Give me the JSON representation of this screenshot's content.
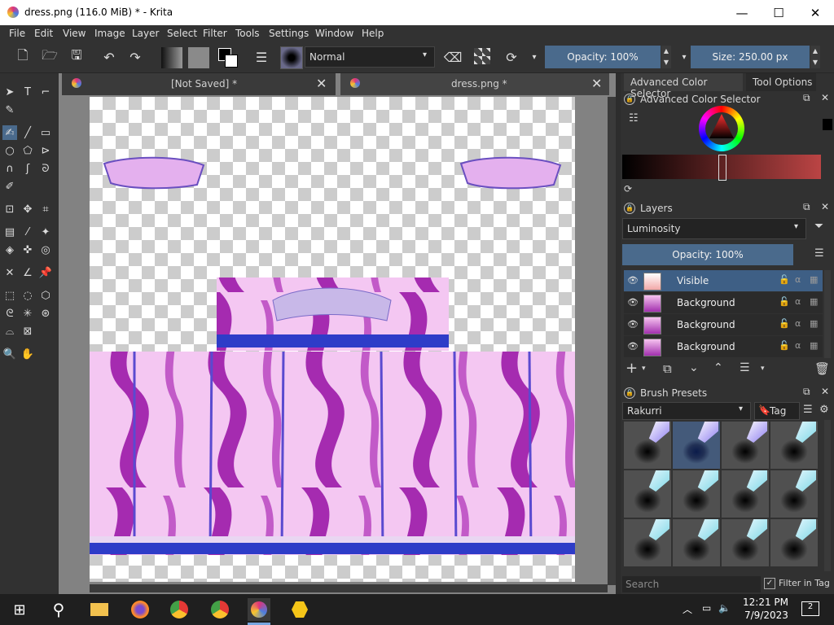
{
  "window": {
    "title": "dress.png (116.0 MiB)  * - Krita",
    "min": "—",
    "max": "☐",
    "close": "✕"
  },
  "menu": [
    "File",
    "Edit",
    "View",
    "Image",
    "Layer",
    "Select",
    "Filter",
    "Tools",
    "Settings",
    "Window",
    "Help"
  ],
  "toolbar": {
    "blend_mode": "Normal",
    "opacity": "Opacity: 100%",
    "size": "Size: 250.00 px"
  },
  "tabs": [
    {
      "label": "[Not Saved]  *",
      "close": "✕"
    },
    {
      "label": "dress.png *",
      "close": "✕"
    }
  ],
  "dockers": {
    "tab_color": "Advanced Color Selector",
    "tab_tool": "Tool Options",
    "color_panel_title": "Advanced Color Selector",
    "layers_title": "Layers",
    "layer_blend": "Luminosity",
    "layer_opacity": "Opacity:  100%",
    "layers": [
      {
        "name": "Visible",
        "selected": true
      },
      {
        "name": "Background",
        "selected": false
      },
      {
        "name": "Background",
        "selected": false
      },
      {
        "name": "Background",
        "selected": false
      }
    ],
    "brush_title": "Brush Presets",
    "brush_tag_combo": "Rakurri",
    "brush_tag_btn": "Tag",
    "search_placeholder": "Search",
    "filter_in_tag": "Filter in Tag"
  },
  "taskbar": {
    "time": "12:21 PM",
    "date": "7/9/2023",
    "notif": "2"
  },
  "colors": {
    "accent": "#4a6a8c",
    "selection": "#3e5f85",
    "dress_pink": "#f4c7f2",
    "dress_purple": "#a52bb0",
    "band_blue": "#2e3cc8"
  }
}
